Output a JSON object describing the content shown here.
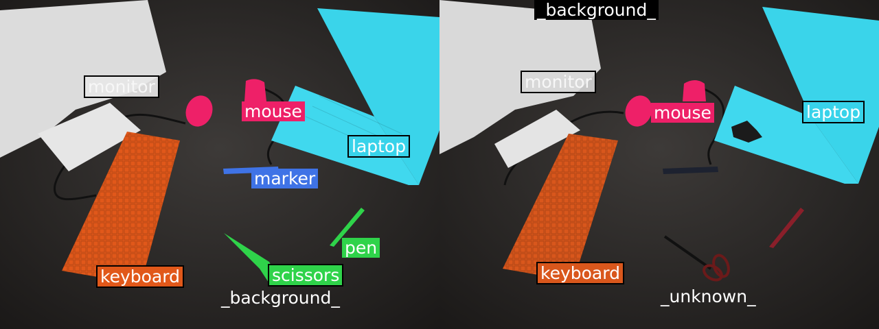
{
  "colors": {
    "table": "#33302f",
    "monitor": "#d9d9d9",
    "mouse": "#f0226a",
    "laptop": "#38d3ea",
    "keyboard": "#e55a16",
    "marker": "#3f73e6",
    "pen": "#2fd34a",
    "scissors": "#2fd34a",
    "background_label": "#000000"
  },
  "left": {
    "labels": {
      "monitor": "monitor",
      "mouse": "mouse",
      "laptop": "laptop",
      "marker": "marker",
      "pen": "pen",
      "scissors": "scissors",
      "keyboard": "keyboard",
      "background": "_background_"
    }
  },
  "right": {
    "labels": {
      "background": "_background_",
      "monitor": "monitor",
      "mouse": "mouse",
      "laptop": "laptop",
      "keyboard": "keyboard",
      "unknown": "_unknown_"
    }
  }
}
